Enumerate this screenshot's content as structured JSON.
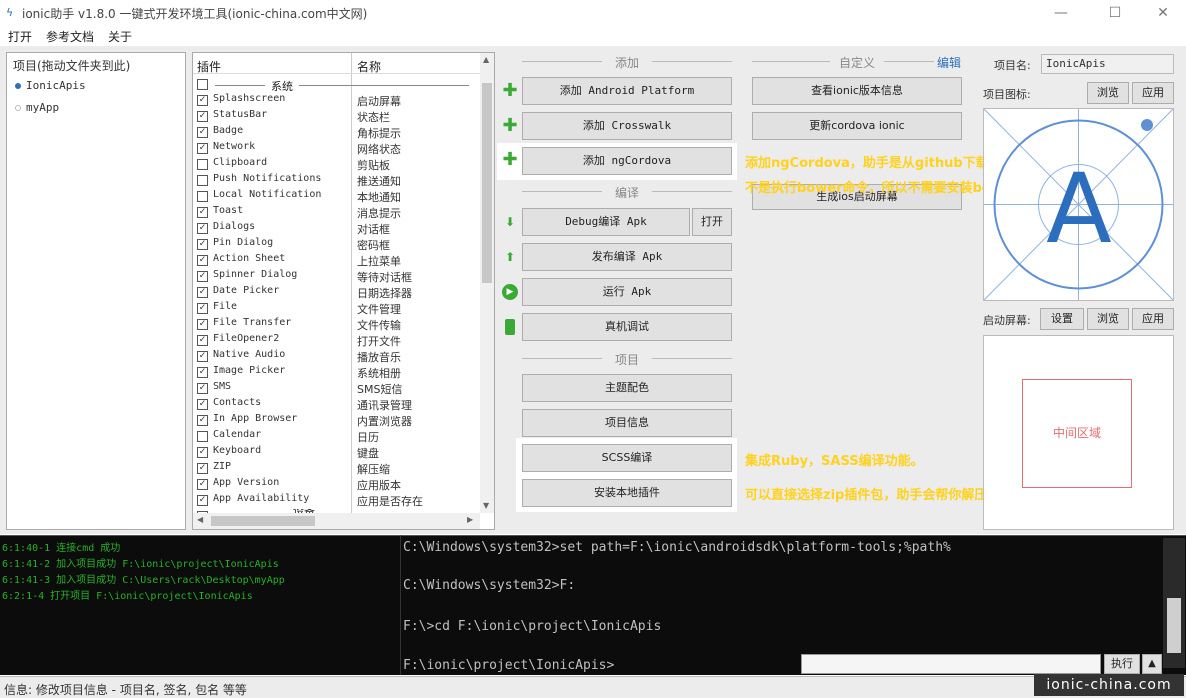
{
  "window": {
    "title": "ionic助手 v1.8.0 一键式开发环境工具(ionic-china.com中文网)",
    "minimize": "—",
    "maximize": "☐",
    "close": "✕"
  },
  "menu": [
    "打开",
    "参考文档",
    "关于"
  ],
  "projects": {
    "header": "项目(拖动文件夹到此)",
    "items": [
      {
        "name": "IonicApis",
        "active": true
      },
      {
        "name": "myApp",
        "active": false
      }
    ]
  },
  "plugins": {
    "col_plugin": "插件",
    "col_name": "名称",
    "group_system": "系统",
    "group_other": "设备",
    "rows": [
      {
        "name": "Splashscreen",
        "cn": "启动屏幕",
        "checked": true
      },
      {
        "name": "StatusBar",
        "cn": "状态栏",
        "checked": true
      },
      {
        "name": "Badge",
        "cn": "角标提示",
        "checked": true
      },
      {
        "name": "Network",
        "cn": "网络状态",
        "checked": true
      },
      {
        "name": "Clipboard",
        "cn": "剪贴板",
        "checked": false
      },
      {
        "name": "Push Notifications",
        "cn": "推送通知",
        "checked": false
      },
      {
        "name": "Local Notification",
        "cn": "本地通知",
        "checked": false
      },
      {
        "name": "Toast",
        "cn": "消息提示",
        "checked": true
      },
      {
        "name": "Dialogs",
        "cn": "对话框",
        "checked": true
      },
      {
        "name": "Pin Dialog",
        "cn": "密码框",
        "checked": true
      },
      {
        "name": "Action Sheet",
        "cn": "上拉菜单",
        "checked": true
      },
      {
        "name": "Spinner Dialog",
        "cn": "等待对话框",
        "checked": true
      },
      {
        "name": "Date Picker",
        "cn": "日期选择器",
        "checked": true
      },
      {
        "name": "File",
        "cn": "文件管理",
        "checked": true
      },
      {
        "name": "File Transfer",
        "cn": "文件传输",
        "checked": true
      },
      {
        "name": "FileOpener2",
        "cn": "打开文件",
        "checked": true
      },
      {
        "name": "Native Audio",
        "cn": "播放音乐",
        "checked": true
      },
      {
        "name": "Image Picker",
        "cn": "系统相册",
        "checked": true
      },
      {
        "name": "SMS",
        "cn": "SMS短信",
        "checked": true
      },
      {
        "name": "Contacts",
        "cn": "通讯录管理",
        "checked": true
      },
      {
        "name": "In App Browser",
        "cn": "内置浏览器",
        "checked": true
      },
      {
        "name": "Calendar",
        "cn": "日历",
        "checked": false
      },
      {
        "name": "Keyboard",
        "cn": "键盘",
        "checked": true
      },
      {
        "name": "ZIP",
        "cn": "解压缩",
        "checked": true
      },
      {
        "name": "App Version",
        "cn": "应用版本",
        "checked": true
      },
      {
        "name": "App Availability",
        "cn": "应用是否存在",
        "checked": true
      }
    ]
  },
  "sections": {
    "add": "添加",
    "compile": "编译",
    "project": "项目",
    "custom": "自定义",
    "edit": "编辑"
  },
  "buttons": {
    "add_android": "添加 Android Platform",
    "add_crosswalk": "添加 Crosswalk",
    "add_ngcordova": "添加 ngCordova",
    "debug_apk": "Debug编译 Apk",
    "open": "打开",
    "release_apk": "发布编译 Apk",
    "run_apk": "运行 Apk",
    "device_debug": "真机调试",
    "theme_color": "主题配色",
    "project_info": "项目信息",
    "scss": "SCSS编译",
    "install_local": "安装本地插件",
    "view_version": "查看ionic版本信息",
    "update_cordova": "更新cordova ionic",
    "gen_ios": "生成ios启动屏幕"
  },
  "annotations": {
    "ngcordova_1": "添加ngCordova，助手是从github下载js添加到项目目录",
    "ngcordova_2": "不是执行bower命令，所以不需要安装bower/git。",
    "scss": "集成Ruby，SASS编译功能。",
    "install": "可以直接选择zip插件包，助手会帮你解压/安装。"
  },
  "right": {
    "project_name_label": "项目名:",
    "project_name_value": "IonicApis",
    "icon_label": "项目图标:",
    "browse": "浏览",
    "apply": "应用",
    "splash_label": "启动屏幕:",
    "settings": "设置",
    "icon_letter": "A",
    "middle_region": "中间区域"
  },
  "log": [
    "6:1:40-1 连接cmd 成功",
    "6:1:41-2 加入项目成功 F:\\ionic\\project\\IonicApis",
    "6:1:41-3 加入项目成功 C:\\Users\\rack\\Desktop\\myApp",
    "6:2:1-4 打开项目 F:\\ionic\\project\\IonicApis"
  ],
  "console": [
    "C:\\Windows\\system32>set path=F:\\ionic\\androidsdk\\platform-tools;%path%",
    "C:\\Windows\\system32>F:",
    "F:\\>cd F:\\ionic\\project\\IonicApis",
    "F:\\ionic\\project\\IonicApis>"
  ],
  "exec": "执行",
  "up": "▲",
  "status": "信息:  修改项目信息 - 项目名, 签名, 包名 等等",
  "watermark": "ionic-china.com",
  "colors": {
    "accent_blue": "#2c6ebd",
    "log_green": "#25b325",
    "annotation_yellow": "#ffd21f",
    "plus_green": "#3aa935"
  }
}
